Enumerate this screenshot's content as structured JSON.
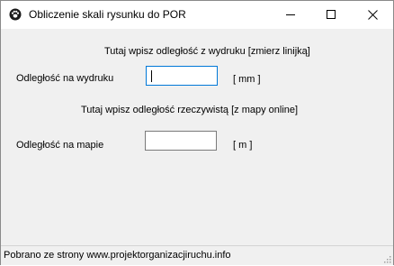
{
  "window": {
    "title": "Obliczenie skali rysunku do POR",
    "controls": {
      "minimize": "minimize-icon",
      "maximize": "maximize-icon",
      "close": "close-icon"
    },
    "app_icon": "paw-icon"
  },
  "form": {
    "print_instruction": "Tutaj wpisz odległość z wydruku [zmierz linijką]",
    "print_label": "Odległość na wydruku",
    "print_value": "",
    "print_unit": "[ mm ]",
    "map_instruction": "Tutaj wpisz odległość rzeczywistą [z mapy online]",
    "map_label": "Odległość na mapie",
    "map_value": "",
    "map_unit": "[ m ]"
  },
  "status": {
    "text": "Pobrano ze strony www.projektorganizacjiruchu.info"
  },
  "colors": {
    "focus_border": "#0078d7",
    "window_bg": "#f0f0f0"
  }
}
